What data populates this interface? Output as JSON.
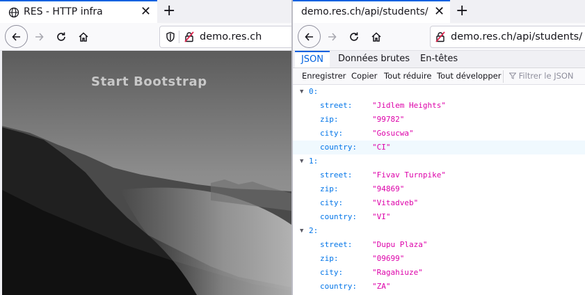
{
  "left_window": {
    "tab_title": "RES - HTTP infra",
    "url": "demo.res.ch",
    "brand": "Start Bootstrap"
  },
  "right_window": {
    "tab_title": "demo.res.ch/api/students/",
    "url": "demo.res.ch/api/students/",
    "viewer_tabs": [
      "JSON",
      "Données brutes",
      "En-têtes"
    ],
    "toolbar": {
      "save": "Enregistrer",
      "copy": "Copier",
      "collapse_all": "Tout réduire",
      "expand_all": "Tout développer",
      "filter_placeholder": "Filtrer le JSON"
    },
    "json_entries": [
      {
        "index": "0:",
        "street": "\"Jidlem Heights\"",
        "zip": "\"99782\"",
        "city": "\"Gosucwa\"",
        "country": "\"CI\""
      },
      {
        "index": "1:",
        "street": "\"Fivav Turnpike\"",
        "zip": "\"94869\"",
        "city": "\"Vitadveb\"",
        "country": "\"VI\""
      },
      {
        "index": "2:",
        "street": "\"Dupu Plaza\"",
        "zip": "\"09699\"",
        "city": "\"Ragahiuze\"",
        "country": "\"ZA\""
      }
    ],
    "keys": {
      "street": "street:",
      "zip": "zip:",
      "city": "city:",
      "country": "country:"
    }
  },
  "colors": {
    "accent": "#0061e0",
    "json_key": "#0074e8",
    "json_string": "#dd00a9"
  },
  "icons": [
    "globe-icon",
    "close-icon",
    "plus-icon",
    "back-arrow-icon",
    "forward-arrow-icon",
    "reload-icon",
    "home-icon",
    "shield-icon",
    "insecure-lock-icon",
    "filter-icon",
    "twisty-icon"
  ]
}
